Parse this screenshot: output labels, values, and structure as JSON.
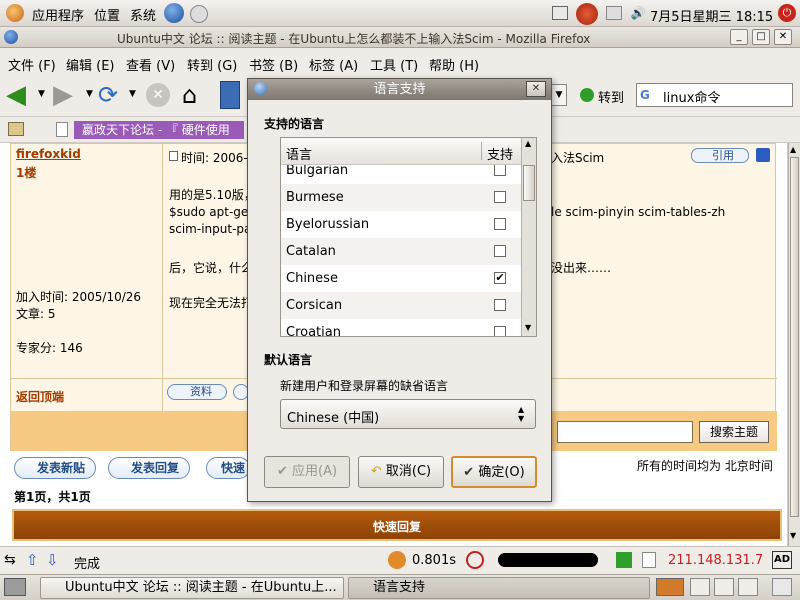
{
  "top_panel": {
    "menus": [
      "应用程序",
      "位置",
      "系统"
    ],
    "clock": "7月5日星期三 18:15"
  },
  "window": {
    "title": "Ubuntu中文 论坛 :: 阅读主题 - 在Ubuntu上怎么都装不上输入法Scim - Mozilla Firefox"
  },
  "menubar": {
    "items": [
      "文件 (F)",
      "编辑 (E)",
      "查看 (V)",
      "转到 (G)",
      "书签 (B)",
      "标签 (A)",
      "工具 (T)",
      "帮助 (H)"
    ]
  },
  "navbar": {
    "go_label": "转到",
    "search_value": "linux命令"
  },
  "bookmarks": {
    "tab1": "嬴政天下论坛 - 『 硬件使用"
  },
  "post": {
    "author": "firefoxkid",
    "floor": "1楼",
    "time_label": "时间: 2006-7",
    "join_date": "加入时间: 2005/10/26",
    "posts": "文章: 5",
    "expert": "专家分: 146",
    "back_top": "返回顶端",
    "quote_btn": "引用",
    "profile_btn": "资料",
    "title_tail": "入法Scim",
    "body_line1": "用的是5.10版，",
    "body_line2": "$sudo apt-ge",
    "body_line2_tail": "le scim-pinyin scim-tables-zh",
    "body_line3": "scim-input-pa",
    "body_line4": "后，它说，什么",
    "body_line4_tail": "没出来……",
    "body_line5": "现在完全无法打"
  },
  "page_footer": {
    "new_post": "发表新贴",
    "reply": "发表回复",
    "quick": "快速",
    "search_btn": "搜索主题",
    "timezone": "所有的时间均为 北京时间",
    "page_info": "第1页，共1页",
    "quick_reply": "快速回复"
  },
  "statusbar": {
    "status": "完成",
    "time": "0.801s",
    "ip": "211.148.131.7",
    "ad": "AD"
  },
  "taskbar": {
    "task1": "Ubuntu中文 论坛 :: 阅读主题 - 在Ubuntu上...",
    "task2": "语言支持"
  },
  "dialog": {
    "title": "语言支持",
    "supported_heading": "支持的语言",
    "col_language": "语言",
    "col_support": "支持",
    "languages": [
      {
        "name": "Bulgarian",
        "checked": false
      },
      {
        "name": "Burmese",
        "checked": false
      },
      {
        "name": "Byelorussian",
        "checked": false
      },
      {
        "name": "Catalan",
        "checked": false
      },
      {
        "name": "Chinese",
        "checked": true
      },
      {
        "name": "Corsican",
        "checked": false
      },
      {
        "name": "Croatian",
        "checked": false
      }
    ],
    "default_heading": "默认语言",
    "default_desc": "新建用户和登录屏幕的缺省语言",
    "default_value": "Chinese (中国)",
    "apply": "应用(A)",
    "cancel": "取消(C)",
    "ok": "确定(O)"
  }
}
